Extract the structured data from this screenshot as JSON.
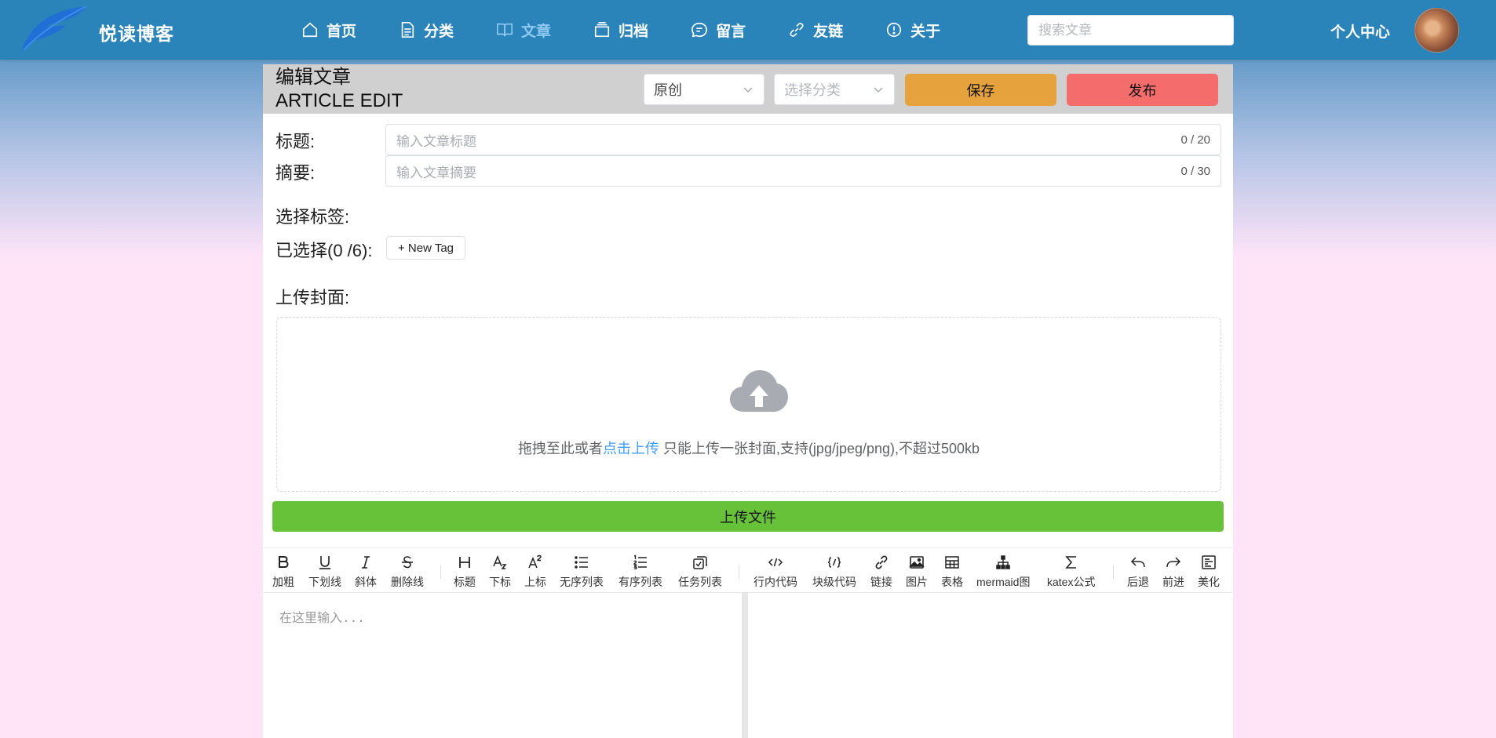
{
  "site": {
    "name": "悦读博客"
  },
  "nav": [
    {
      "label": "首页",
      "icon": "home-icon"
    },
    {
      "label": "分类",
      "icon": "document-icon"
    },
    {
      "label": "文章",
      "icon": "book-icon",
      "active": true
    },
    {
      "label": "归档",
      "icon": "archive-icon"
    },
    {
      "label": "留言",
      "icon": "chat-icon"
    },
    {
      "label": "友链",
      "icon": "link-icon"
    },
    {
      "label": "关于",
      "icon": "info-icon"
    }
  ],
  "search": {
    "placeholder": "搜索文章"
  },
  "user": {
    "center_label": "个人中心"
  },
  "editor": {
    "title_cn": "编辑文章",
    "title_en": "ARTICLE EDIT",
    "type_select": {
      "value": "原创"
    },
    "category_select": {
      "placeholder": "选择分类"
    },
    "save_label": "保存",
    "publish_label": "发布",
    "title_field": {
      "label": "标题:",
      "placeholder": "输入文章标题",
      "count": "0 / 20"
    },
    "summary_field": {
      "label": "摘要:",
      "placeholder": "输入文章摘要",
      "count": "0 / 30"
    },
    "tags": {
      "label": "选择标签:",
      "selected_label": "已选择(0 /6):",
      "new_tag_label": "+ New Tag"
    },
    "cover": {
      "label": "上传封面:",
      "drop_text_prefix": "拖拽至此或者",
      "drop_text_link": "点击上传",
      "drop_text_suffix": " 只能上传一张封面,支持(jpg/jpeg/png),不超过500kb"
    },
    "upload_button_label": "上传文件"
  },
  "md_toolbar": [
    {
      "label": "加粗",
      "icon": "bold-icon"
    },
    {
      "label": "下划线",
      "icon": "underline-icon"
    },
    {
      "label": "斜体",
      "icon": "italic-icon"
    },
    {
      "label": "删除线",
      "icon": "strikethrough-icon"
    },
    {
      "label": "标题",
      "icon": "heading-icon"
    },
    {
      "label": "下标",
      "icon": "subscript-icon"
    },
    {
      "label": "上标",
      "icon": "superscript-icon"
    },
    {
      "label": "无序列表",
      "icon": "bullet-list-icon"
    },
    {
      "label": "有序列表",
      "icon": "ordered-list-icon"
    },
    {
      "label": "任务列表",
      "icon": "task-list-icon"
    },
    {
      "label": "行内代码",
      "icon": "inline-code-icon"
    },
    {
      "label": "块级代码",
      "icon": "code-block-icon"
    },
    {
      "label": "链接",
      "icon": "link-icon"
    },
    {
      "label": "图片",
      "icon": "image-icon"
    },
    {
      "label": "表格",
      "icon": "table-icon"
    },
    {
      "label": "mermaid图",
      "icon": "mermaid-diagram-icon"
    },
    {
      "label": "katex公式",
      "icon": "sigma-icon"
    },
    {
      "label": "后退",
      "icon": "undo-icon"
    },
    {
      "label": "前进",
      "icon": "redo-icon"
    },
    {
      "label": "美化",
      "icon": "prettier-icon"
    }
  ],
  "md_editor": {
    "placeholder": "在这里输入..."
  },
  "colors": {
    "topbar": "#2a83b9",
    "active_nav": "#8fc8f2",
    "save": "#e6a23c",
    "publish": "#f56c6c",
    "upload": "#67c23a",
    "link": "#409eff"
  }
}
